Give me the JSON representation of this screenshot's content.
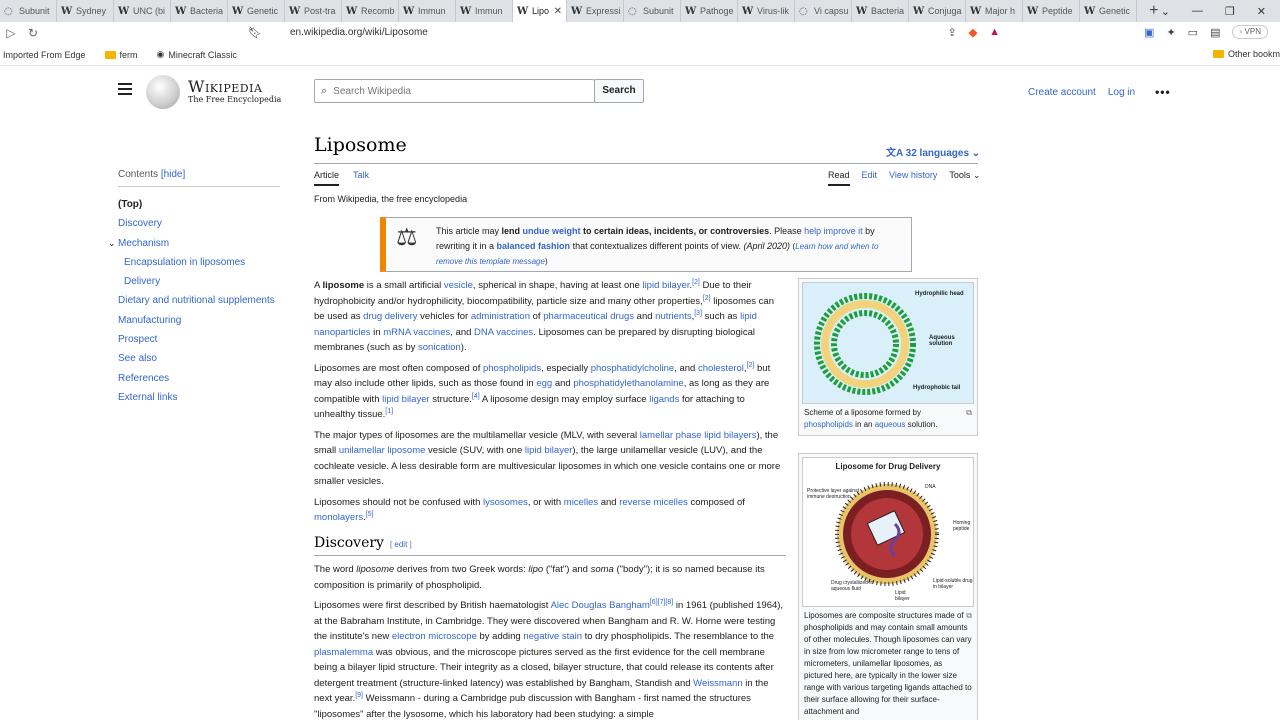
{
  "browser": {
    "tabs": [
      {
        "label": "Subunit",
        "fav": "◌"
      },
      {
        "label": "Sydney",
        "fav": "W"
      },
      {
        "label": "UNC (bi",
        "fav": "W"
      },
      {
        "label": "Bacteria",
        "fav": "W"
      },
      {
        "label": "Genetic",
        "fav": "W"
      },
      {
        "label": "Post-tra",
        "fav": "W"
      },
      {
        "label": "Recomb",
        "fav": "W"
      },
      {
        "label": "Immun",
        "fav": "W"
      },
      {
        "label": "Immun",
        "fav": "W"
      },
      {
        "label": "Lipo",
        "fav": "W",
        "active": true
      },
      {
        "label": "Expressi",
        "fav": "W"
      },
      {
        "label": "Subunit",
        "fav": "◌"
      },
      {
        "label": "Pathoge",
        "fav": "W"
      },
      {
        "label": "Virus-lik",
        "fav": "W"
      },
      {
        "label": "Vi capsu",
        "fav": "◌"
      },
      {
        "label": "Bacteria",
        "fav": "W"
      },
      {
        "label": "Conjuga",
        "fav": "W"
      },
      {
        "label": "Major h",
        "fav": "W"
      },
      {
        "label": "Peptide",
        "fav": "W"
      },
      {
        "label": "Genetic",
        "fav": "W"
      }
    ],
    "url": "en.wikipedia.org/wiki/Liposome",
    "vpn_label": "VPN",
    "bookmarks": [
      {
        "label": "Imported From Edge",
        "icon": "none"
      },
      {
        "label": "ferm",
        "icon": "folder"
      },
      {
        "label": "Minecraft Classic",
        "icon": "globe"
      }
    ],
    "other_bookmarks": "Other bookm"
  },
  "header": {
    "logo_word": "Wikipedia",
    "logo_tagline": "The Free Encyclopedia",
    "search_placeholder": "Search Wikipedia",
    "search_button": "Search",
    "create_account": "Create account",
    "log_in": "Log in"
  },
  "toc": {
    "heading": "Contents",
    "hide": "[hide]",
    "items": [
      {
        "label": "(Top)",
        "level": "top"
      },
      {
        "label": "Discovery",
        "level": 1
      },
      {
        "label": "Mechanism",
        "level": 1,
        "expanded": true
      },
      {
        "label": "Encapsulation in liposomes",
        "level": 2
      },
      {
        "label": "Delivery",
        "level": 2
      },
      {
        "label": "Dietary and nutritional supplements",
        "level": 1
      },
      {
        "label": "Manufacturing",
        "level": 1
      },
      {
        "label": "Prospect",
        "level": 1
      },
      {
        "label": "See also",
        "level": 1
      },
      {
        "label": "References",
        "level": 1
      },
      {
        "label": "External links",
        "level": 1
      }
    ]
  },
  "article": {
    "title": "Liposome",
    "languages": "32 languages",
    "tab_article": "Article",
    "tab_talk": "Talk",
    "tab_read": "Read",
    "tab_edit": "Edit",
    "tab_history": "View history",
    "tab_tools": "Tools",
    "from": "From Wikipedia, the free encyclopedia",
    "notice": {
      "t1": "This article may ",
      "t2": "lend ",
      "t3": "undue weight",
      "t4": " to certain ideas, incidents, or controversies",
      "t5": ". Please ",
      "t6": "help improve it",
      "t7": " by rewriting it in a ",
      "t8": "balanced fashion",
      "t9": " that contextualizes different points of view. ",
      "t10": "(April 2020)",
      "t11": "Learn how and when to remove this template message"
    },
    "p1": [
      "A ",
      "liposome",
      " is a small artificial ",
      "vesicle",
      ", spherical in shape, having at least one ",
      "lipid bilayer",
      ".",
      "[2]",
      " Due to their hydrophobicity and/or hydrophilicity, biocompatibility, particle size and many other properties,",
      "[2]",
      " liposomes can be used as ",
      "drug delivery",
      " vehicles for ",
      "administration",
      " of ",
      "pharmaceutical drugs",
      " and ",
      "nutrients",
      ",",
      "[3]",
      " such as ",
      "lipid nanoparticles",
      " in ",
      "mRNA vaccines",
      ", and ",
      "DNA vaccines",
      ". Liposomes can be prepared by disrupting biological membranes (such as by ",
      "sonication",
      ")."
    ],
    "p2": [
      "Liposomes are most often composed of ",
      "phospholipids",
      ", especially ",
      "phosphatidylcholine",
      ", and ",
      "cholesterol",
      ",",
      "[2]",
      " but may also include other lipids, such as those found in ",
      "egg",
      " and ",
      "phosphatidylethanolamine",
      ", as long as they are compatible with ",
      "lipid bilayer",
      " structure.",
      "[4]",
      " A liposome design may employ surface ",
      "ligands",
      " for attaching to unhealthy tissue.",
      "[1]"
    ],
    "p3": [
      "The major types of liposomes are the multilamellar vesicle (MLV, with several ",
      "lamellar phase lipid bilayers",
      "), the small ",
      "unilamellar liposome",
      " vesicle (SUV, with one ",
      "lipid bilayer",
      "), the large unilamellar vesicle (LUV), and the cochleate vesicle. A less desirable form are multivesicular liposomes in which one vesicle contains one or more smaller vesicles."
    ],
    "p4": [
      "Liposomes should not be confused with ",
      "lysosomes",
      ", or with ",
      "micelles",
      " and ",
      "reverse micelles",
      " composed of ",
      "monolayers",
      ".",
      "[5]"
    ],
    "discovery_heading": "Discovery",
    "edit_label": "edit",
    "d1": [
      "The word ",
      "liposome",
      " derives from two Greek words: ",
      "lipo",
      " (\"fat\") and ",
      "soma",
      " (\"body\"); it is so named because its composition is primarily of phospholipid."
    ],
    "d2": [
      "Liposomes were first described by British haematologist ",
      "Alec Douglas Bangham",
      "[6][7][8]",
      " in 1961 (published 1964), at the Babraham Institute, in Cambridge. They were discovered when Bangham and R. W. Horne were testing the institute's new ",
      "electron microscope",
      " by adding ",
      "negative stain",
      " to dry phospholipids. The resemblance to the ",
      "plasmalemma",
      " was obvious, and the microscope pictures served as the first evidence for the cell membrane being a bilayer lipid structure. Their integrity as a closed, bilayer structure, that could release its contents after detergent treatment (structure-linked latency) was established by Bangham, Standish and ",
      "Weissmann",
      " in the next year.",
      "[9]",
      " Weissmann - during a Cambridge pub discussion with Bangham - first named the structures \"liposomes\" after the lysosome, which his laboratory had been studying: a simple"
    ]
  },
  "figures": {
    "fig1": {
      "labels": [
        "Hydrophilic head",
        "Aqueous solution",
        "Hydrophobic tail"
      ],
      "caption": [
        "Scheme of a liposome formed by ",
        "phospholipids",
        " in an ",
        "aqueous",
        " solution."
      ]
    },
    "fig2": {
      "title": "Liposome for Drug Delivery",
      "labels": [
        "Protective layer against immune destruction",
        "DNA",
        "Homing peptide",
        "Drug crystallized in aqueous fluid",
        "Lipid bilayer",
        "Lipid-soluble drug in bilayer"
      ],
      "caption": "Liposomes are composite structures made of phospholipids and may contain small amounts of other molecules. Though liposomes can vary in size from low micrometer range to tens of micrometers, unilamellar liposomes, as pictured here, are typically in the lower size range with various targeting ligands attached to their surface allowing for their surface-attachment and"
    }
  },
  "colors": {
    "link": "#3366cc",
    "notice_bar": "#f28500",
    "diagram_bg": "#d9f0fb",
    "lipid_green": "#1e9e3a"
  }
}
